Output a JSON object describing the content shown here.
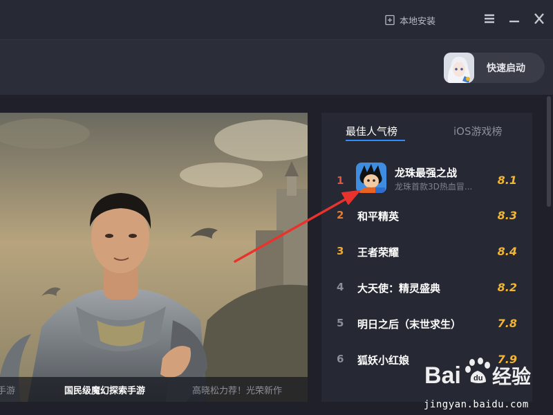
{
  "titlebar": {
    "local_install_label": "本地安装",
    "icons": [
      "local-install-icon",
      "menu-icon",
      "minimize-icon",
      "close-icon"
    ]
  },
  "toolbar": {
    "quick_launch_label": "快速启动"
  },
  "banner": {
    "caption_left": "手游",
    "caption_middle": "国民级魔幻探索手游",
    "caption_right": "高晓松力荐！光荣新作"
  },
  "ranking": {
    "tabs": [
      {
        "label": "最佳人气榜",
        "active": true
      },
      {
        "label": "iOS游戏榜",
        "active": false
      }
    ],
    "items": [
      {
        "rank": "1",
        "name": "龙珠最强之战",
        "desc": "龙珠首款3D热血冒...",
        "score": "8.1",
        "rank_color": "#e8553f"
      },
      {
        "rank": "2",
        "name": "和平精英",
        "score": "8.3",
        "rank_color": "#e87a2f"
      },
      {
        "rank": "3",
        "name": "王者荣耀",
        "score": "8.4",
        "rank_color": "#f0a928"
      },
      {
        "rank": "4",
        "name": "大天使：精灵盛典",
        "score": "8.2",
        "rank_color": "#8c8f99"
      },
      {
        "rank": "5",
        "name": "明日之后（末世求生）",
        "score": "7.8",
        "rank_color": "#8c8f99"
      },
      {
        "rank": "6",
        "name": "狐妖小红娘",
        "score": "7.9",
        "rank_color": "#8c8f99"
      }
    ]
  },
  "watermark": {
    "url": "jingyan.baidu.com"
  },
  "colors": {
    "accent": "#2f8cff",
    "score": "#f2b534",
    "annotation_arrow": "#e8332d"
  }
}
